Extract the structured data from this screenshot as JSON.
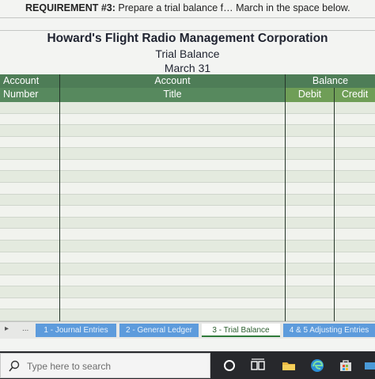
{
  "requirement": {
    "label": "REQUIREMENT #3:",
    "text": " Prepare a trial balance f… March in the space below."
  },
  "statement": {
    "company": "Howard's Flight Radio Management Corporation",
    "name": "Trial Balance",
    "date": "March 31"
  },
  "table": {
    "header_row_1": {
      "account": "Account",
      "account_title": "Account",
      "balance": "Balance"
    },
    "header_row_2": {
      "number": "Number",
      "title": "Title",
      "debit": "Debit",
      "credit": "Credit"
    },
    "row_count": 19
  },
  "tabs": {
    "nav_prev": "▸",
    "nav_more": "...",
    "items": [
      {
        "label": "1 - Journal Entries"
      },
      {
        "label": "2 - General Ledger"
      },
      {
        "label": "3 - Trial Balance"
      },
      {
        "label": "4 & 5 Adjusting Entries"
      }
    ],
    "active_index": 2
  },
  "taskbar": {
    "search_placeholder": "Type here to search",
    "icons": [
      "cortana-icon",
      "task-view-icon",
      "file-explorer-icon",
      "edge-icon",
      "store-icon",
      "mail-icon"
    ]
  },
  "colors": {
    "header_green": "#4e7d57",
    "debit_credit_green": "#6f9e57",
    "tab_blue": "#5d9bdc",
    "taskbar": "#27282c"
  }
}
